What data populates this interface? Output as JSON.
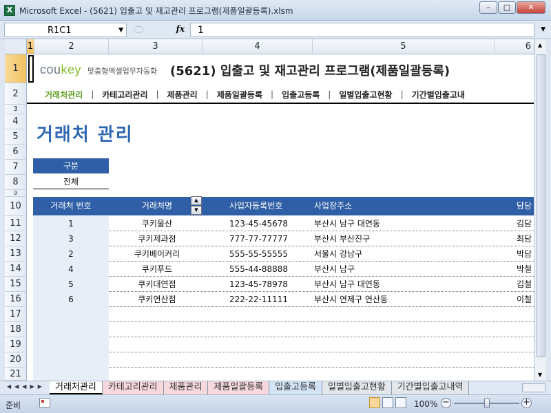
{
  "window": {
    "title": "Microsoft Excel - (5621) 입출고 및 재고관리 프로그램(제품일괄등록).xlsm",
    "controls": [
      "–",
      "□",
      "✕"
    ]
  },
  "formula_bar": {
    "name_box": "R1C1",
    "formula": "1",
    "fx_label": "fx"
  },
  "columns": [
    "1",
    "2",
    "3",
    "4",
    "5",
    "6"
  ],
  "rows": [
    "1",
    "2",
    "3",
    "4",
    "5",
    "6",
    "7",
    "8",
    "9",
    "10",
    "11",
    "12",
    "13",
    "14",
    "15",
    "16",
    "17",
    "18",
    "19",
    "20",
    "21"
  ],
  "header": {
    "logo": "coukey",
    "logo_sub": "맞춤형엑셀업무자동화",
    "title": "(5621) 입출고 및 재고관리 프로그램(제품일괄등록)"
  },
  "nav": [
    "거래처관리",
    "카테고리관리",
    "제품관리",
    "제품일괄등록",
    "입출고등록",
    "일별입출고현황",
    "기간별입출고내"
  ],
  "page_title": "거래처 관리",
  "filter": {
    "label": "구분",
    "value": "전체"
  },
  "table": {
    "columns": [
      "거래처 번호",
      "거래처명",
      "사업자등록번호",
      "사업장주소",
      "담당"
    ],
    "rows": [
      [
        "1",
        "쿠키울산",
        "123-45-45678",
        "부산시 남구 대연동",
        "김담"
      ],
      [
        "3",
        "쿠키제과점",
        "777-77-77777",
        "부산시 부산진구",
        "최담"
      ],
      [
        "2",
        "쿠키베이커리",
        "555-55-55555",
        "서울시 강남구",
        "박담"
      ],
      [
        "4",
        "쿠키푸드",
        "555-44-88888",
        "부산시 남구",
        "박철"
      ],
      [
        "5",
        "쿠키대연점",
        "123-45-78978",
        "부산시 남구 대연동",
        "김철"
      ],
      [
        "6",
        "쿠키연산점",
        "222-22-11111",
        "부산시 연제구 연산동",
        "이철"
      ]
    ]
  },
  "sheet_tabs": [
    "거래처관리",
    "카테고리관리",
    "제품관리",
    "제품일괄등록",
    "입출고등록",
    "일별입출고현황",
    "기간별입출고내역"
  ],
  "status": {
    "ready": "준비",
    "zoom": "100%"
  },
  "colors": {
    "accent": "#2f5fa6",
    "title_blue": "#2e67b3",
    "nav_active": "#5e9a1f"
  }
}
